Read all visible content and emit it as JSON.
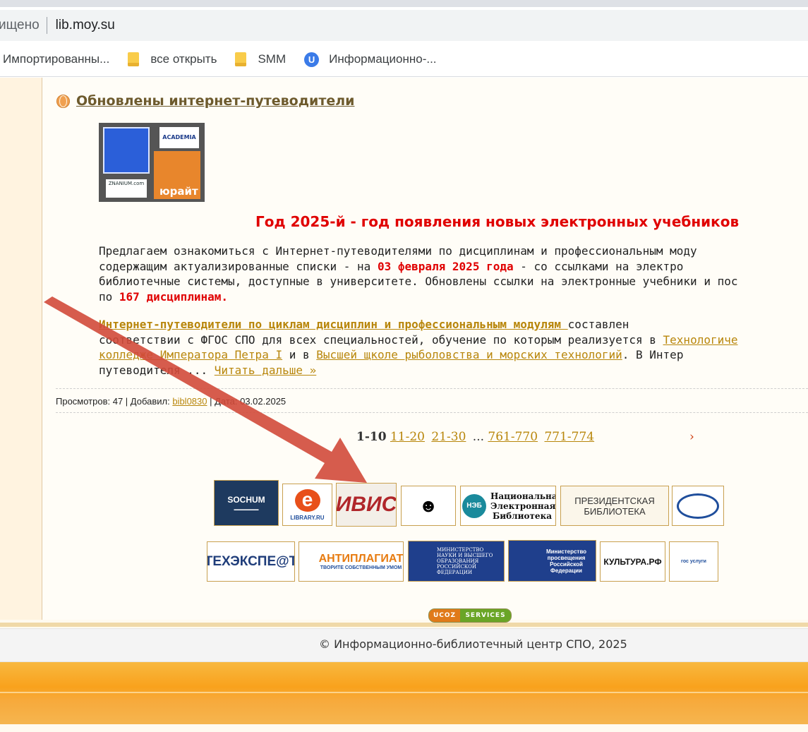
{
  "browser": {
    "secure_label": "ищено",
    "url": "lib.moy.su",
    "bookmarks": [
      {
        "label": "Импортированны...",
        "icon": "none"
      },
      {
        "label": "все открыть",
        "icon": "folder-icon"
      },
      {
        "label": "SMM",
        "icon": "folder-icon"
      },
      {
        "label": "Информационно-...",
        "icon": "u-avatar-icon",
        "avatar_letter": "U"
      }
    ]
  },
  "news": {
    "title": "Обновлены интернет-путеводители",
    "thumb": {
      "label_academia": "ACADEMIA",
      "label_urait": "юрайт",
      "label_znanium": "ZNANIUM.com"
    },
    "headline": "Год 2025-й - год появления новых электронных учебников",
    "p1": {
      "l1": "Предлагаем ознакомиться с Интернет-путеводителями по дисциплинам и профессиональным моду",
      "l2a": "содержащим актуализированные списки -  на ",
      "l2b": "03 февраля 2025 года",
      "l2c": "  - со ссылками на электро",
      "l3": "библиотечные системы, доступные в университете. Обновлены ссылки на электронные учебники и пос",
      "l4a": "по ",
      "l4b": "167 дисциплинам."
    },
    "p2": {
      "link1": "Интернет-путеводители по циклам дисциплин и профессиональным модулям ",
      "l1b": "составлен",
      "l2a": "соответствии с ФГОС СПО для всех специальностей, обучение по которым реализуется в ",
      "link2": "Технологиче",
      "link3": "колледже Императора Петра I",
      "l3b": " и в ",
      "link4": "Высшей щколе рыболовства и морских технологий",
      "l3d": ". В Интер",
      "l4a": "путеводителя ... ",
      "read_more": "Читать дальше »"
    },
    "meta": {
      "views_label": "Просмотров: 47 | Добавил: ",
      "author": "bibl0830",
      "date_label": " | Дата: 03.02.2025"
    }
  },
  "pager": {
    "current": "1-10",
    "pages": [
      "11-20",
      "21-30"
    ],
    "ellipsis": "...",
    "last_pages": [
      "761-770",
      "771-774"
    ],
    "next": "›"
  },
  "banners": {
    "sochum": "SOCHUM",
    "elibrary": "e",
    "elibrary_sub": "LIBRARY.RU",
    "ivis": "ИВИС",
    "neb_short": "НЭБ",
    "neb_full": "Национальная Электронная Библиотека",
    "presidential": "ПРЕЗИДЕНТСКАЯ БИБЛИОТЕКА",
    "texexpert": "ТЕХЭКСПЕ@Т",
    "antiplagiat": "АНТИПЛАГИАТ",
    "antiplagiat_sub": "ТВОРИТЕ СОБСТВЕННЫМ УМОМ",
    "minobr": "МИНИСТЕРСТВО НАУКИ И ВЫСШЕГО ОБРАЗОВАНИЯ РОССИЙСКОЙ ФЕДЕРАЦИИ",
    "minpros": "Министерство просвещения Российской Федерации",
    "kultura": "КУЛЬТУРА.РФ",
    "gosuslugi": "гос услуги"
  },
  "footer": {
    "copyright": "© Информационно-библиотечный центр СПО, 2025",
    "ucoz_left": "UCOZ",
    "ucoz_right": "SERVICES"
  },
  "colors": {
    "accent_link": "#b8860b",
    "headline_red": "#e00000",
    "arrow_red": "#d24a3a",
    "footer_orange": "#f9a21c"
  }
}
